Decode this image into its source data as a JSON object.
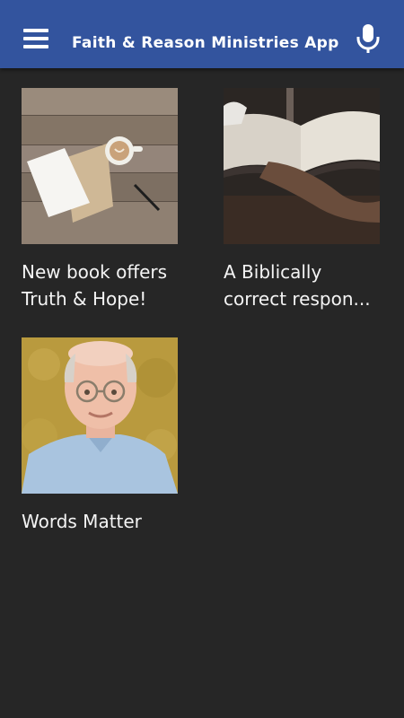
{
  "header": {
    "title": "Faith & Reason Ministries App",
    "menu_icon": "hamburger-menu-icon",
    "mic_icon": "microphone-icon",
    "bar_color": "#33549e"
  },
  "articles": [
    {
      "title_line1": "New book offers",
      "title_line2": "Truth & Hope!",
      "image": "desk-notebook-coffee-photo"
    },
    {
      "title_line1": "A Biblically",
      "title_line2": "correct respon...",
      "image": "hands-holding-bible-photo"
    },
    {
      "title_line1": "Words Matter",
      "title_line2": "",
      "image": "author-portrait-photo"
    }
  ],
  "colors": {
    "background": "#262626",
    "text": "#f4f4f4"
  }
}
